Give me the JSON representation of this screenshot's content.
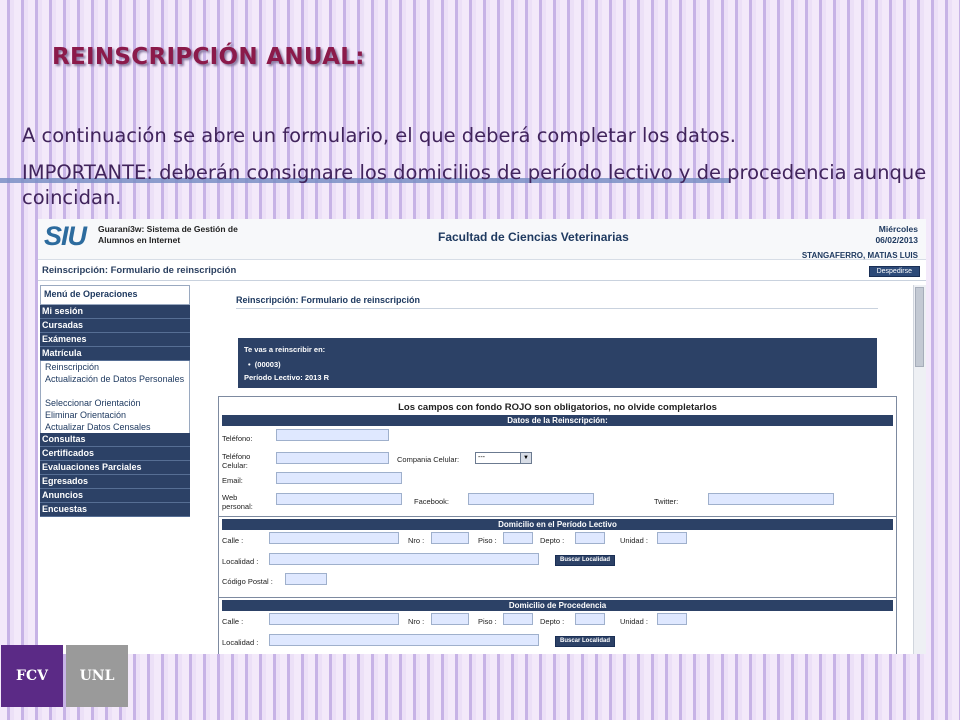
{
  "slide": {
    "title": "REINSCRIPCIÓN ANUAL:",
    "line1": "A continuación se abre un formulario, el que deberá completar los datos.",
    "line2": "IMPORTANTE: deberán consignare los domicilios de período lectivo y de procedencia aunque coincidan."
  },
  "app": {
    "logo": "SIU",
    "system_name": "Guaraní3w: Sistema de Gestión de Alumnos en Internet",
    "faculty": "Facultad de Ciencias Veterinarias",
    "day": "Miércoles",
    "date": "06/02/2013",
    "user": "STANGAFERRO, MATIAS LUIS",
    "breadcrumb": "Reinscripción: Formulario de reinscripción",
    "logout_label": "Despedirse"
  },
  "menu": {
    "header": "Menú de Operaciones",
    "items_top": [
      "Mi sesión",
      "Cursadas",
      "Exámenes",
      "Matrícula"
    ],
    "sub_items": [
      "Reinscripción",
      "Actualización de Datos Personales",
      "Seleccionar Orientación",
      "Eliminar Orientación",
      "Actualizar Datos Censales"
    ],
    "items_bottom": [
      "Consultas",
      "Certificados",
      "Evaluaciones Parciales",
      "Egresados",
      "Anuncios",
      "Encuestas"
    ]
  },
  "content": {
    "page_title": "Reinscripción: Formulario de reinscripción",
    "info_label": "Te vas a reinscribir en:",
    "info_item": "(00003)",
    "info_period": "Período Lectivo: 2013 R"
  },
  "form": {
    "notice": "Los campos con fondo ROJO son obligatorios, no olvide completarlos",
    "section1": "Datos de la Reinscripción:",
    "telefono": "Teléfono:",
    "telefono_celular": "Teléfono Celular:",
    "compania_celular": "Compania Celular:",
    "compania_value": "---",
    "email": "Email:",
    "web": "Web personal:",
    "facebook": "Facebook:",
    "twitter": "Twitter:",
    "section2": "Domicilio en el Período Lectivo",
    "section3": "Domicilio de Procedencia",
    "calle": "Calle :",
    "nro": "Nro :",
    "piso": "Piso :",
    "depto": "Depto :",
    "unidad": "Unidad :",
    "localidad": "Localidad :",
    "buscar_localidad": "Buscar Localidad",
    "codigo_postal": "Código Postal :"
  },
  "footer": {
    "logo1": "FCV",
    "logo2": "UNL"
  },
  "colors": {
    "title": "#8b1a4a",
    "text": "#41245c",
    "app_dark": "#2c4166",
    "input_fill": "#dfe8ff"
  }
}
